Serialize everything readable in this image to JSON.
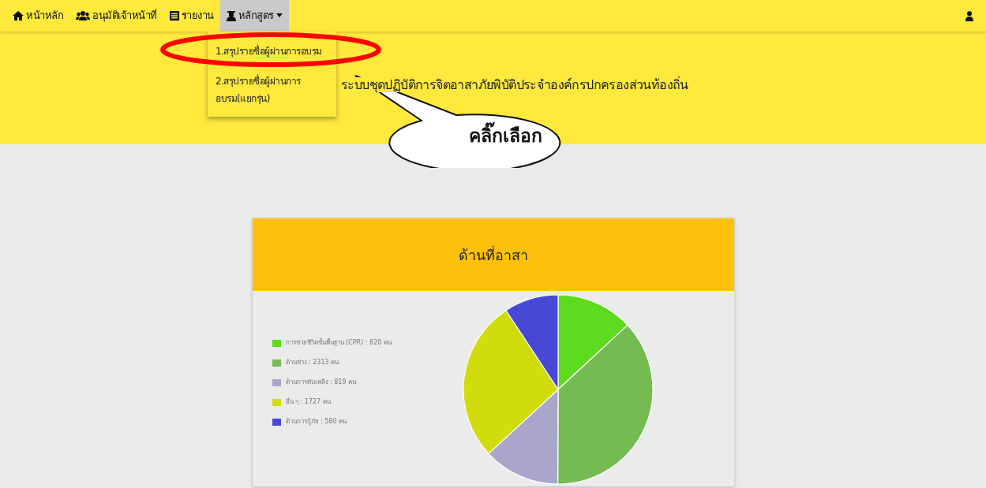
{
  "navbar": {
    "items": [
      {
        "label": "หน้าหลัก",
        "kind": "home",
        "selected": false,
        "dropdown": false
      },
      {
        "label": "อนุมัติเจ้าหน้าที่",
        "kind": "users",
        "selected": false,
        "dropdown": false
      },
      {
        "label": "รายงาน",
        "kind": "list",
        "selected": false,
        "dropdown": false
      },
      {
        "label": "หลักสูตร",
        "kind": "graduate",
        "selected": true,
        "dropdown": true
      }
    ]
  },
  "dropdown_menu": {
    "items": [
      {
        "label": "1.สรุปรายชื่อผู้ผ่านการอบรม",
        "circled": true
      },
      {
        "label": "2.สรุปรายชื่อผู้ผ่านการอบรม(แยกรุ่น)",
        "circled": false
      }
    ]
  },
  "banner": {
    "title": "ระบบชุดปฏิบัติการจิตอาสาภัยพิบัติประจำองค์กรปกครองส่วนท้องถิ่น"
  },
  "callout": {
    "text": "คลิ๊กเลือก"
  },
  "chart_card": {
    "title": "ด้านที่อาสา",
    "chart_data": {
      "type": "pie",
      "categories": [
        "การช่วยชีวิตขั้นพื้นฐาน (CPR) : 820 คน",
        "ด้านช่าง : 2313 คน",
        "ด้านการดับเพลิง : 819 คน",
        "อื่น ๆ : 1727 คน",
        "ด้านการกู้ภัย : 580 คน"
      ],
      "values": [
        820,
        2313,
        819,
        1727,
        580
      ],
      "colors": [
        "#5ddb1e",
        "#74bb52",
        "#aaa6c9",
        "#d0dc0b",
        "#4649d6"
      ]
    }
  }
}
